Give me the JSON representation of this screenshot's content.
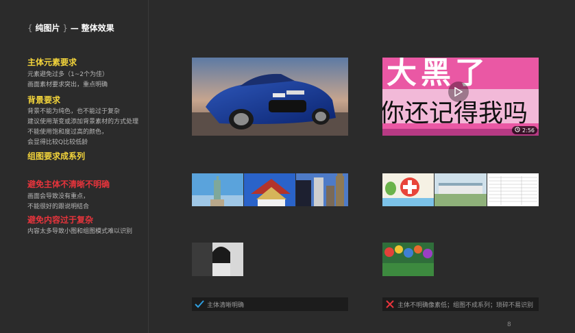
{
  "title": {
    "brace_open": "{",
    "label": "纯图片",
    "brace_close": "}",
    "dash": "—",
    "subtitle": "整体效果"
  },
  "sections": [
    {
      "heading": "主体元素要求",
      "color": "#f3d43b",
      "lines": [
        "元素避免过多（1~2个为佳）",
        "画面素材要求突出，重点明确"
      ]
    },
    {
      "heading": "背景要求",
      "color": "#f3d43b",
      "lines": [
        "背景不能为纯色，也不能过于复杂",
        "建议使用渐变或添加背景素材的方式处理",
        "不能使用饱和度过高的颜色，",
        "会显得比较Q比较低龄"
      ]
    },
    {
      "heading": "组图要求成系列",
      "color": "#f3d43b",
      "lines": []
    },
    {
      "heading": "避免主体不清晰不明确",
      "color": "#e8343c",
      "lines": [
        "画面会导致没有重点，",
        "不能很好的跟说明结合"
      ]
    },
    {
      "heading": "避免内容过于复杂",
      "color": "#e8343c",
      "lines": [
        "内容太多导致小图和组图模式难以识别"
      ]
    }
  ],
  "good_column": {
    "video_thumb": {
      "alt": "car image"
    },
    "group_thumbs": [
      "statue of liberty",
      "pagoda roof",
      "city buildings signs",
      "big ben"
    ],
    "small_thumb": {
      "alt": "person portrait"
    },
    "caption": "主体清晰明确",
    "caption_icon": "check-icon"
  },
  "bad_column": {
    "video_thumb": {
      "text_line1": "大黑了",
      "text_line2": "你还记得我吗",
      "duration": "2:56",
      "play_icon": "play-icon",
      "clock_icon": "clock-icon"
    },
    "group_thumbs": [
      "cartoon pharmacy",
      "building rendering",
      "document table"
    ],
    "small_thumb": {
      "alt": "colorful crowd"
    },
    "caption": "主体不明确像素低；组图不成系列；琐碎不易识别",
    "caption_icon": "cross-icon"
  },
  "page_number": "8",
  "colors": {
    "accent_yellow": "#f3d43b",
    "accent_red": "#e8343c",
    "check_blue": "#2f9fe0",
    "cross_red": "#e8343c"
  }
}
